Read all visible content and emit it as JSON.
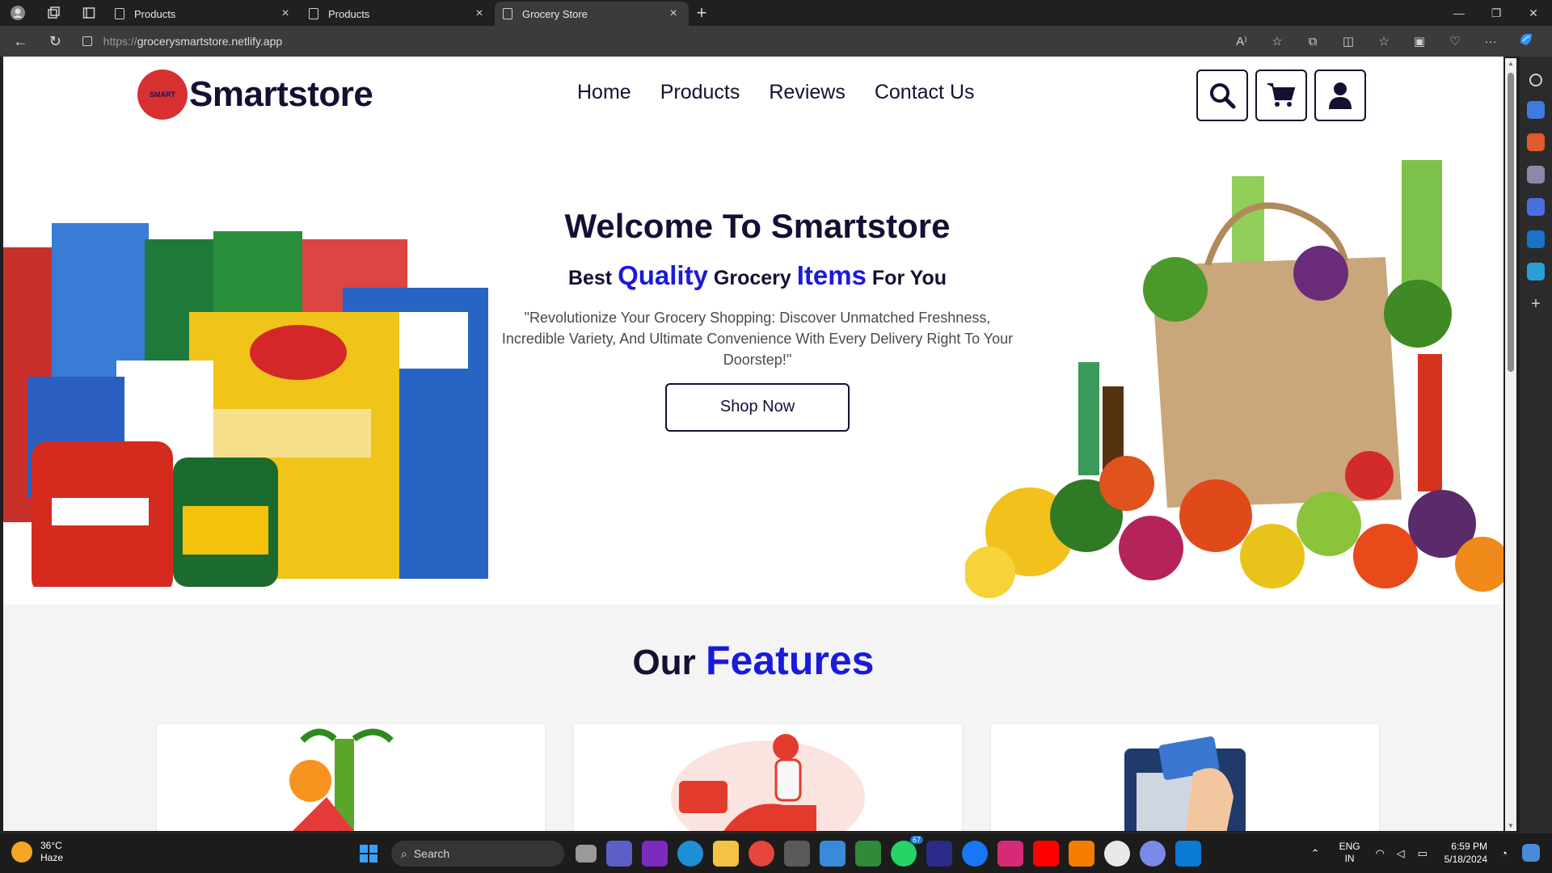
{
  "browser": {
    "tabs": [
      {
        "title": "Products",
        "active": false
      },
      {
        "title": "Products",
        "active": false
      },
      {
        "title": "Grocery Store",
        "active": true
      }
    ],
    "url_proto": "https://",
    "url_host": "grocerysmartstore.netlify.app"
  },
  "site": {
    "logo_text": "Smartstore",
    "logo_badge": "SMART",
    "nav": [
      "Home",
      "Products",
      "Reviews",
      "Contact Us"
    ],
    "hero": {
      "title": "Welcome To Smartstore",
      "sub_1": "Best",
      "sub_hl_1": "Quality",
      "sub_2": "Grocery",
      "sub_hl_2": "Items",
      "sub_3": "For You",
      "description": "\"Revolutionize Your Grocery Shopping: Discover Unmatched Freshness, Incredible Variety, And Ultimate Convenience With Every Delivery Right To Your Doorstep!\"",
      "button": "Shop Now"
    },
    "features": {
      "title_plain": "Our",
      "title_hl": "Features"
    }
  },
  "taskbar": {
    "weather_temp": "36°C",
    "weather_desc": "Haze",
    "search_placeholder": "Search",
    "lang_1": "ENG",
    "lang_2": "IN",
    "time": "6:59 PM",
    "date": "5/18/2024",
    "whatsapp_badge": "67"
  },
  "colors": {
    "brand_dark": "#141033",
    "accent_blue": "#1a1adb",
    "logo_red": "#d63031"
  }
}
